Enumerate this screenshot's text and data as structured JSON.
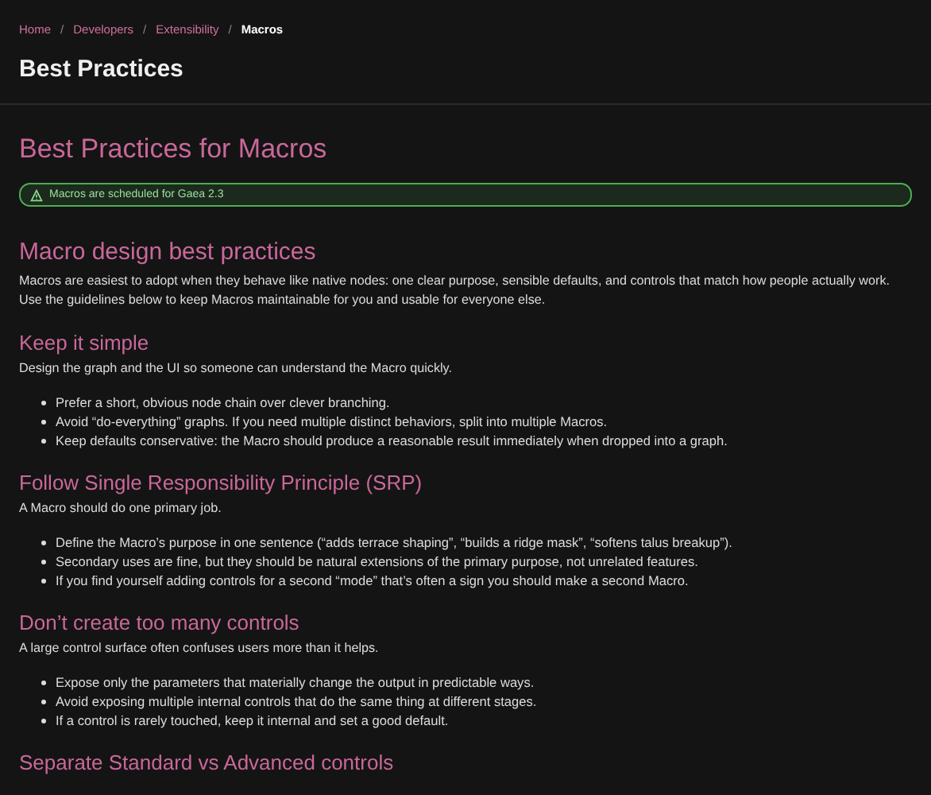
{
  "breadcrumb": [
    {
      "label": "Home",
      "current": false
    },
    {
      "label": "Developers",
      "current": false
    },
    {
      "label": "Extensibility",
      "current": false
    },
    {
      "label": "Macros",
      "current": true
    }
  ],
  "breadcrumb_separator": "/",
  "page_title": "Best Practices",
  "article_title": "Best Practices for Macros",
  "callout": {
    "text": "Macros are scheduled for Gaea 2.3"
  },
  "intro": {
    "heading": "Macro design best practices",
    "text": "Macros are easiest to adopt when they behave like native nodes: one clear purpose, sensible defaults, and controls that match how people actually work. Use the guidelines below to keep Macros maintainable for you and usable for everyone else."
  },
  "sections": [
    {
      "heading": "Keep it simple",
      "text": "Design the graph and the UI so someone can understand the Macro quickly.",
      "bullets": [
        "Prefer a short, obvious node chain over clever branching.",
        "Avoid “do-everything” graphs. If you need multiple distinct behaviors, split into multiple Macros.",
        "Keep defaults conservative: the Macro should produce a reasonable result immediately when dropped into a graph."
      ]
    },
    {
      "heading": "Follow Single Responsibility Principle (SRP)",
      "text": "A Macro should do one primary job.",
      "bullets": [
        "Define the Macro’s purpose in one sentence (“adds terrace shaping”, “builds a ridge mask”, “softens talus breakup”).",
        "Secondary uses are fine, but they should be natural extensions of the primary purpose, not unrelated features.",
        "If you find yourself adding controls for a second “mode” that’s often a sign you should make a second Macro."
      ]
    },
    {
      "heading": "Don’t create too many controls",
      "text": "A large control surface often confuses users more than it helps.",
      "bullets": [
        "Expose only the parameters that materially change the output in predictable ways.",
        "Avoid exposing multiple internal controls that do the same thing at different stages.",
        "If a control is rarely touched, keep it internal and set a good default."
      ]
    },
    {
      "heading": "Separate Standard vs Advanced controls"
    }
  ]
}
